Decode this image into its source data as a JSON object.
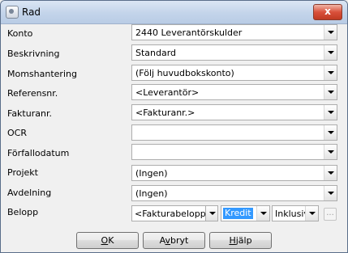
{
  "window": {
    "title": "Rad",
    "close_label": "x"
  },
  "fields": [
    {
      "label": "Konto",
      "value": "2440 Leverantörskulder"
    },
    {
      "label": "Beskrivning",
      "value": "Standard"
    },
    {
      "label": "Momshantering",
      "value": "(Följ huvudbokskonto)"
    },
    {
      "label": "Referensnr.",
      "value": "<Leverantör>"
    },
    {
      "label": "Fakturanr.",
      "value": "<Fakturanr.>"
    },
    {
      "label": "OCR",
      "value": ""
    },
    {
      "label": "Förfallodatum",
      "value": ""
    },
    {
      "label": "Projekt",
      "value": "(Ingen)"
    },
    {
      "label": "Avdelning",
      "value": "(Ingen)"
    }
  ],
  "belopp": {
    "label": "Belopp",
    "amount_value": "<Fakturabelopp>",
    "side_value": "Kredit",
    "tax_value": "Inklusive",
    "ellipsis_label": "..."
  },
  "buttons": {
    "ok_u": "O",
    "ok_rest": "K",
    "cancel_pre": "A",
    "cancel_u": "v",
    "cancel_rest": "bryt",
    "help_u": "H",
    "help_rest": "jälp"
  }
}
